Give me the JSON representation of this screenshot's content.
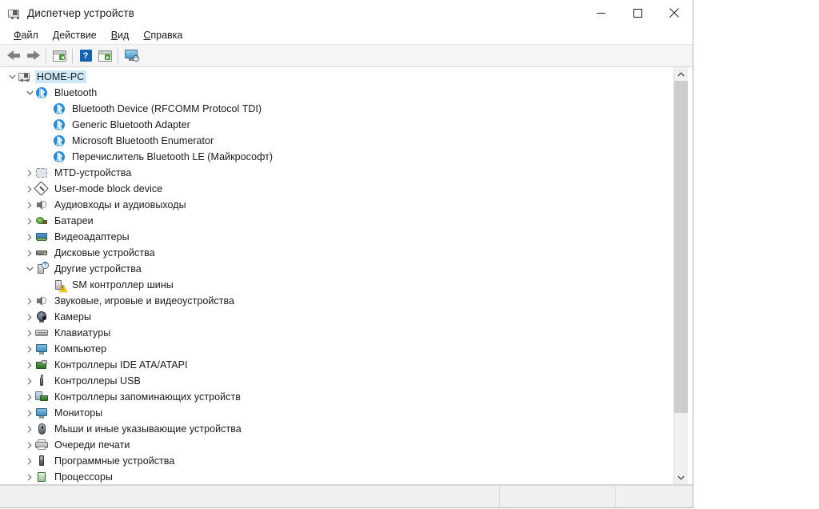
{
  "window": {
    "title": "Диспетчер устройств",
    "title_icon": "device-manager-icon",
    "caption": {
      "minimize": "minimize-icon",
      "maximize": "maximize-icon",
      "close": "close-icon"
    }
  },
  "menubar": {
    "items": [
      {
        "label": "Файл",
        "accesskey": "Ф",
        "rest": "айл"
      },
      {
        "label": "Действие",
        "accesskey": "Д",
        "rest": "ействие"
      },
      {
        "label": "Вид",
        "accesskey": "В",
        "rest": "ид"
      },
      {
        "label": "Справка",
        "accesskey": "С",
        "rest": "правка"
      }
    ]
  },
  "toolbar": {
    "buttons": [
      {
        "name": "back-button",
        "icon": "arrow-left-icon"
      },
      {
        "name": "forward-button",
        "icon": "arrow-right-icon"
      },
      {
        "name": "properties-button",
        "icon": "window-green-left-icon"
      },
      {
        "name": "help-button",
        "icon": "help-question-icon",
        "glyph": "?"
      },
      {
        "name": "scan-button",
        "icon": "window-green-right-icon"
      },
      {
        "name": "show-hidden-devices-button",
        "icon": "monitor-search-icon"
      }
    ]
  },
  "tree": {
    "selected": "HOME-PC",
    "nodes": [
      {
        "label": "HOME-PC",
        "level": 0,
        "state": "expanded",
        "icon": "computer-icon",
        "selected": true
      },
      {
        "label": "Bluetooth",
        "level": 1,
        "state": "expanded",
        "icon": "bluetooth-icon"
      },
      {
        "label": "Bluetooth Device (RFCOMM Protocol TDI)",
        "level": 2,
        "state": "leaf",
        "icon": "bluetooth-icon"
      },
      {
        "label": "Generic Bluetooth Adapter",
        "level": 2,
        "state": "leaf",
        "icon": "bluetooth-icon"
      },
      {
        "label": "Microsoft Bluetooth Enumerator",
        "level": 2,
        "state": "leaf",
        "icon": "bluetooth-icon"
      },
      {
        "label": "Перечислитель Bluetooth LE (Майкрософт)",
        "level": 2,
        "state": "leaf",
        "icon": "bluetooth-icon"
      },
      {
        "label": "MTD-устройства",
        "level": 1,
        "state": "collapsed",
        "icon": "mtd-device-icon"
      },
      {
        "label": "User-mode block device",
        "level": 1,
        "state": "collapsed",
        "icon": "user-mode-block-device-icon"
      },
      {
        "label": "Аудиовходы и аудиовыходы",
        "level": 1,
        "state": "collapsed",
        "icon": "audio-icon"
      },
      {
        "label": "Батареи",
        "level": 1,
        "state": "collapsed",
        "icon": "battery-icon"
      },
      {
        "label": "Видеоадаптеры",
        "level": 1,
        "state": "collapsed",
        "icon": "display-adapter-icon"
      },
      {
        "label": "Дисковые устройства",
        "level": 1,
        "state": "collapsed",
        "icon": "disk-drive-icon"
      },
      {
        "label": "Другие устройства",
        "level": 1,
        "state": "expanded",
        "icon": "other-device-icon"
      },
      {
        "label": "SM контроллер шины",
        "level": 2,
        "state": "leaf",
        "icon": "other-device-warning-icon",
        "warning": true
      },
      {
        "label": "Звуковые, игровые и видеоустройства",
        "level": 1,
        "state": "collapsed",
        "icon": "audio-icon"
      },
      {
        "label": "Камеры",
        "level": 1,
        "state": "collapsed",
        "icon": "camera-icon"
      },
      {
        "label": "Клавиатуры",
        "level": 1,
        "state": "collapsed",
        "icon": "keyboard-icon"
      },
      {
        "label": "Компьютер",
        "level": 1,
        "state": "collapsed",
        "icon": "monitor-icon"
      },
      {
        "label": "Контроллеры IDE ATA/ATAPI",
        "level": 1,
        "state": "collapsed",
        "icon": "ide-controller-icon"
      },
      {
        "label": "Контроллеры USB",
        "level": 1,
        "state": "collapsed",
        "icon": "usb-controller-icon"
      },
      {
        "label": "Контроллеры запоминающих устройств",
        "level": 1,
        "state": "collapsed",
        "icon": "storage-controller-icon"
      },
      {
        "label": "Мониторы",
        "level": 1,
        "state": "collapsed",
        "icon": "monitor-icon"
      },
      {
        "label": "Мыши и иные указывающие устройства",
        "level": 1,
        "state": "collapsed",
        "icon": "mouse-icon"
      },
      {
        "label": "Очереди печати",
        "level": 1,
        "state": "collapsed",
        "icon": "printer-icon"
      },
      {
        "label": "Программные устройства",
        "level": 1,
        "state": "collapsed",
        "icon": "software-device-icon"
      },
      {
        "label": "Процессоры",
        "level": 1,
        "state": "collapsed",
        "icon": "processor-icon"
      }
    ]
  },
  "scrollbar": {
    "up_arrow": "chevron-up-icon",
    "down_arrow": "chevron-down-icon"
  },
  "statusbar": {
    "cells": [
      "",
      "",
      ""
    ]
  },
  "colors": {
    "selection": "#cde8f7",
    "bluetooth": "#1b8ae0",
    "warning": "#f0c419",
    "accent_blue": "#1463ae"
  }
}
